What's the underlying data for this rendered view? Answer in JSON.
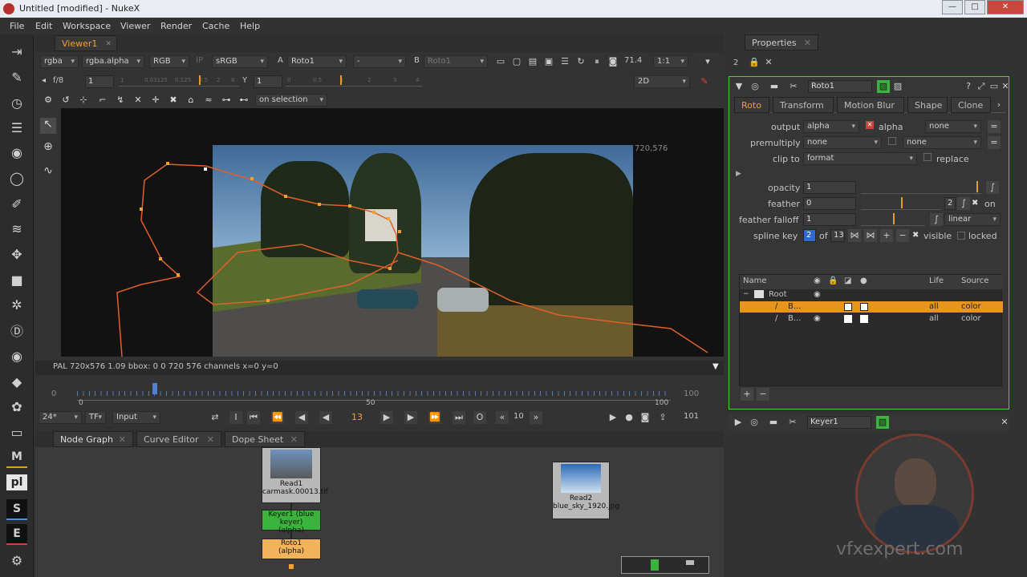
{
  "window": {
    "title": "Untitled [modified] - NukeX",
    "minimize": "—",
    "maximize": "□",
    "close": "✕"
  },
  "menu": [
    "File",
    "Edit",
    "Workspace",
    "Viewer",
    "Render",
    "Cache",
    "Help"
  ],
  "viewer_tab": {
    "label": "Viewer1",
    "close": "✕"
  },
  "viewer_bar": {
    "channels": "rgba",
    "channel_alpha": "rgba.alpha",
    "display": "RGB",
    "ip": "IP",
    "lut": "sRGB",
    "a_label": "A",
    "a_input": "Roto1",
    "dash": "-",
    "b_label": "B",
    "b_input": "Roto1",
    "zoom": "71.4",
    "ratio": "1:1"
  },
  "viewer_bar2": {
    "fstop": "f/8",
    "gain": "1",
    "y_label": "Y",
    "gamma": "1",
    "mode": "2D",
    "gain_ticks": [
      "1",
      "0.03125",
      "0.125",
      "0.5",
      "2",
      "8"
    ],
    "gamma_ticks": [
      "0",
      "0.5",
      "1",
      "2",
      "3",
      "4"
    ]
  },
  "roto_tools": {
    "selection": "on selection"
  },
  "viewer_info": {
    "format_label": "720,576",
    "status": "PAL 720x576 1.09  bbox: 0 0 720 576 channels  x=0 y=0"
  },
  "timeline": {
    "start": "0",
    "end": "100",
    "marks": [
      "0",
      "50",
      "100"
    ],
    "right": "100",
    "fps": "24*",
    "tf": "TF",
    "input": "Input",
    "current_frame": "13",
    "step": "10",
    "end_frame": "101"
  },
  "bottom_tabs": [
    {
      "label": "Node Graph"
    },
    {
      "label": "Curve Editor"
    },
    {
      "label": "Dope Sheet"
    }
  ],
  "nodes": {
    "read1": "Read1",
    "read1_file": "carmask.00013.tif",
    "keyer1": "Keyer1 (blue keyer)",
    "keyer1_sub": "(alpha)",
    "roto1": "Roto1",
    "roto1_sub": "(alpha)",
    "read2": "Read2",
    "read2_file": "blue_sky_1920.jpg"
  },
  "properties": {
    "tab": "Properties",
    "count": "2",
    "node_name": "Roto1",
    "tabs": [
      "Roto",
      "Transform",
      "Motion Blur",
      "Shape",
      "Clone"
    ],
    "output_label": "output",
    "output_value": "alpha",
    "output_check": "alpha",
    "output_none": "none",
    "premult_label": "premultiply",
    "premult_value": "none",
    "premult_none": "none",
    "clipto_label": "clip to",
    "clipto_value": "format",
    "replace": "replace",
    "opacity_label": "opacity",
    "opacity_value": "1",
    "opacity_ticks": [
      "0",
      "0.1",
      "0.2",
      "0.3",
      "0.4",
      "0.5",
      "0.6",
      "0.7",
      "0.8",
      "0.9",
      "1"
    ],
    "feather_label": "feather",
    "feather_value": "0",
    "feather_ticks": [
      "-100",
      "-50",
      "0",
      "50",
      "100"
    ],
    "feather_num": "2",
    "feather_on": "on",
    "falloff_label": "feather falloff",
    "falloff_value": "1",
    "falloff_interp": "linear",
    "falloff_ticks": [
      "0",
      "1",
      "2",
      "3",
      "4",
      "5"
    ],
    "spline_label": "spline key",
    "spline_value": "2",
    "spline_of": "of",
    "spline_total": "13",
    "visible": "visible",
    "locked": "locked",
    "layers_header": {
      "name": "Name",
      "life": "Life",
      "source": "Source"
    },
    "layers": [
      {
        "name": "Root"
      },
      {
        "name": "B...",
        "life": "all",
        "source": "color"
      },
      {
        "name": "B...",
        "life": "all",
        "source": "color"
      }
    ],
    "add": "+",
    "remove": "−"
  },
  "keyer_panel": {
    "node_name": "Keyer1"
  },
  "watermark": {
    "site": "vfxexpert.com"
  },
  "colors": {
    "accent": "#f0a030",
    "spline": "#e0602a",
    "keyer": "#3cb33c",
    "roto_node": "#f2b35a",
    "selected_row": "#e8951e"
  },
  "left_tools": [
    "play-icon",
    "brush-icon",
    "clock-icon",
    "list-icon",
    "sphere-icon",
    "circle-icon",
    "pen-icon",
    "layers-icon",
    "move-icon",
    "cube-icon",
    "particle-icon",
    "d-icon",
    "eye-icon",
    "tag-icon",
    "gizmo-icon",
    "drive-icon"
  ],
  "left_text_tools": {
    "m": "M",
    "pl": "pl",
    "s": "S",
    "e": "E"
  }
}
